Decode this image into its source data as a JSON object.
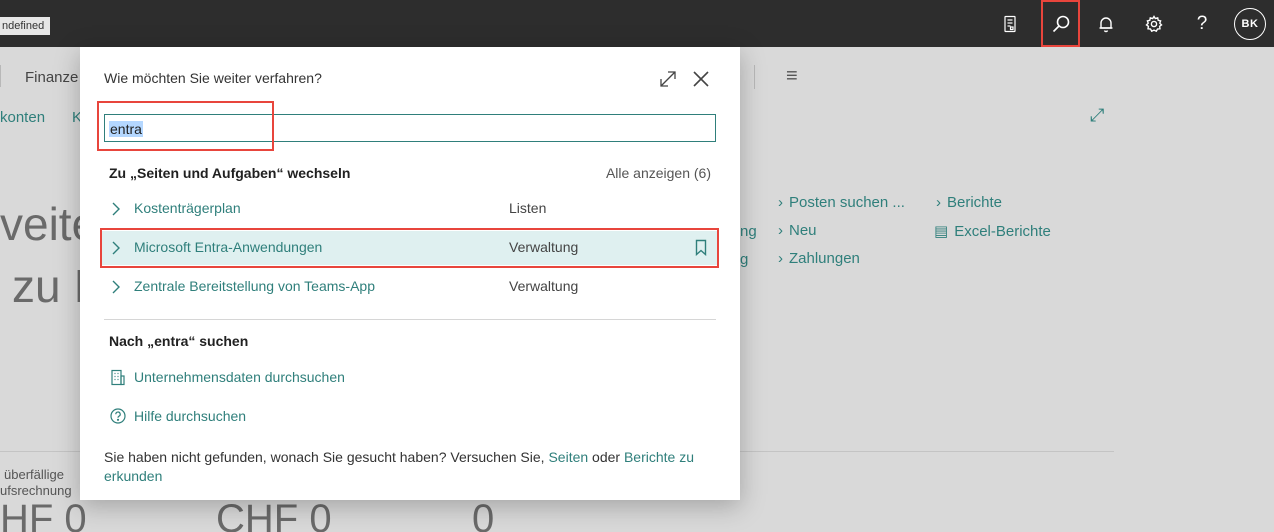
{
  "topbar": {
    "env_label": "ndefined",
    "icons": [
      "document-icon",
      "search-icon",
      "bell-icon",
      "gear-icon",
      "help-icon"
    ],
    "help_glyph": "?",
    "avatar_initials": "BK"
  },
  "background": {
    "nav_item": "Finanze",
    "sub_links": [
      "konten",
      "K"
    ],
    "big_lines": [
      "veite",
      "zu I"
    ],
    "actions_col1": [
      "Posten suchen ...",
      "Neu",
      "Zahlungen"
    ],
    "actions_col2": [
      "Berichte",
      "Excel-Berichte"
    ],
    "partial_col0": [
      "ng",
      "g"
    ],
    "cue_label_lines": [
      "überfällige",
      "ufsrechnung"
    ],
    "cue_values": [
      "HF 0",
      "CHF 0",
      "0"
    ]
  },
  "dialog": {
    "title": "Wie möchten Sie weiter verfahren?",
    "search_value": "entra",
    "pages_section": {
      "heading": "Zu „Seiten und Aufgaben“ wechseln",
      "show_all": "Alle anzeigen (6)",
      "results": [
        {
          "name": "Kostenträgerplan",
          "category": "Listen"
        },
        {
          "name": "Microsoft Entra-Anwendungen",
          "category": "Verwaltung"
        },
        {
          "name": "Zentrale Bereitstellung von Teams-App",
          "category": "Verwaltung"
        }
      ]
    },
    "search_section": {
      "heading": "Nach „entra“ suchen",
      "items": [
        {
          "label": "Unternehmensdaten durchsuchen",
          "icon": "building-icon"
        },
        {
          "label": "Hilfe durchsuchen",
          "icon": "help-circle-icon"
        }
      ]
    },
    "footer": {
      "text": "Sie haben nicht gefunden, wonach Sie gesucht haben? Versuchen Sie,",
      "link_pages": "Seiten",
      "connector": "oder",
      "link_reports": "Berichte zu erkunden"
    }
  },
  "colors": {
    "accent": "#2f7f7b",
    "highlight_border": "#e8453c",
    "selected_row": "#dff0f0",
    "topbar": "#2d2d2d"
  }
}
